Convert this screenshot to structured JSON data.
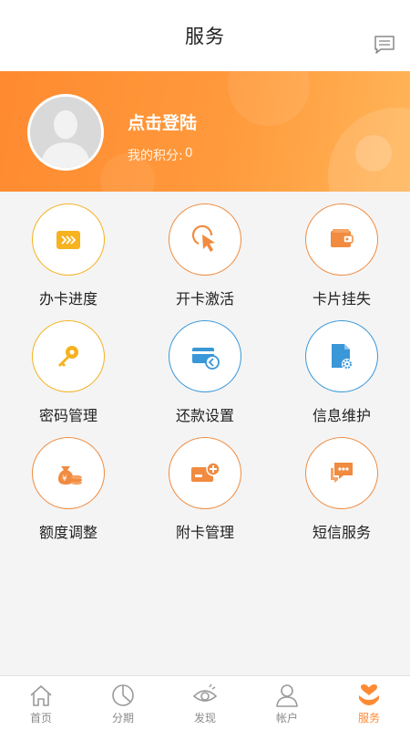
{
  "header": {
    "title": "服务",
    "message_icon": "message-icon"
  },
  "profile": {
    "login_label": "点击登陆",
    "points_label": "我的积分:",
    "points_value": "0",
    "avatar_icon": "default-avatar-icon"
  },
  "services": [
    {
      "label": "办卡进度",
      "icon": "forward-arrows-icon",
      "ring": "gold"
    },
    {
      "label": "开卡激活",
      "icon": "cursor-click-icon",
      "ring": "orange"
    },
    {
      "label": "卡片挂失",
      "icon": "wallet-icon",
      "ring": "orange"
    },
    {
      "label": "密码管理",
      "icon": "key-icon",
      "ring": "gold"
    },
    {
      "label": "还款设置",
      "icon": "card-refund-icon",
      "ring": "blue"
    },
    {
      "label": "信息维护",
      "icon": "document-gear-icon",
      "ring": "blue"
    },
    {
      "label": "额度调整",
      "icon": "money-bag-icon",
      "ring": "orange"
    },
    {
      "label": "附卡管理",
      "icon": "card-add-icon",
      "ring": "orange"
    },
    {
      "label": "短信服务",
      "icon": "chat-icon",
      "ring": "orange"
    }
  ],
  "tabs": [
    {
      "label": "首页",
      "icon": "home-icon",
      "active": false
    },
    {
      "label": "分期",
      "icon": "pie-chart-icon",
      "active": false
    },
    {
      "label": "发现",
      "icon": "eye-icon",
      "active": false
    },
    {
      "label": "帐户",
      "icon": "user-icon",
      "active": false
    },
    {
      "label": "服务",
      "icon": "heart-hand-icon",
      "active": true
    }
  ],
  "colors": {
    "accent": "#ff8a34",
    "gold": "#f5b21d",
    "blue": "#3a97d8",
    "tab_inactive": "#8a8a8a"
  }
}
